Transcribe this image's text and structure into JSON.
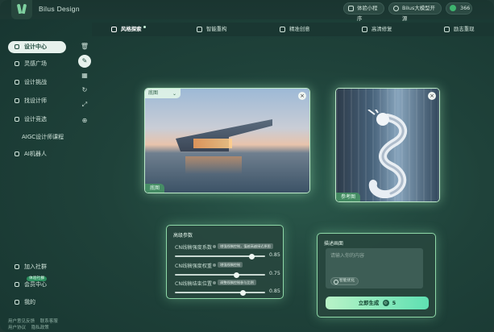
{
  "header": {
    "brand": "Bilus Design",
    "mini_program": "体验小程序",
    "big_model": "Bilus大模型开源",
    "coins": "366"
  },
  "sidebar": {
    "items": [
      {
        "label": "设计中心"
      },
      {
        "label": "灵感广场"
      },
      {
        "label": "设计挑战"
      },
      {
        "label": "找设计师"
      },
      {
        "label": "设计竞选"
      },
      {
        "label": "AIGC设计师课程"
      },
      {
        "label": "AI机器人"
      }
    ],
    "bottom": [
      {
        "label": "加入社群",
        "badge": "体验社群"
      },
      {
        "label": "会员中心"
      },
      {
        "label": "我的"
      }
    ],
    "footer": [
      "用户意见反馈",
      "联系客服",
      "用户协议",
      "隐私政策"
    ]
  },
  "tabs": [
    {
      "label": "风格探索"
    },
    {
      "label": "智能重构"
    },
    {
      "label": "精准创意"
    },
    {
      "label": "高清修复"
    },
    {
      "label": "励志重现"
    }
  ],
  "canvas": {
    "base_label": "底图",
    "base_select": "底图",
    "ref_label": "参考图"
  },
  "params": {
    "title": "高级参数",
    "items": [
      {
        "name": "CN线稿强度系数",
        "tag": "增强线稿控制，值越高越接近原图",
        "value": "0.85",
        "level": 0.85
      },
      {
        "name": "CN线稿强度权重",
        "tag": "增强线稿控制",
        "value": "0.75",
        "level": 0.68
      },
      {
        "name": "CN线稿结束位置",
        "tag": "调整线稿控制参与比例",
        "value": "0.85",
        "level": 0.75
      }
    ]
  },
  "description": {
    "title": "描述画面",
    "placeholder": "请输入你的内容",
    "optimize": "智能优化",
    "generate": "立即生成",
    "cost": "5"
  },
  "colors": {
    "accent": "#5fe0b2",
    "active_bg": "#e6f1ec"
  }
}
